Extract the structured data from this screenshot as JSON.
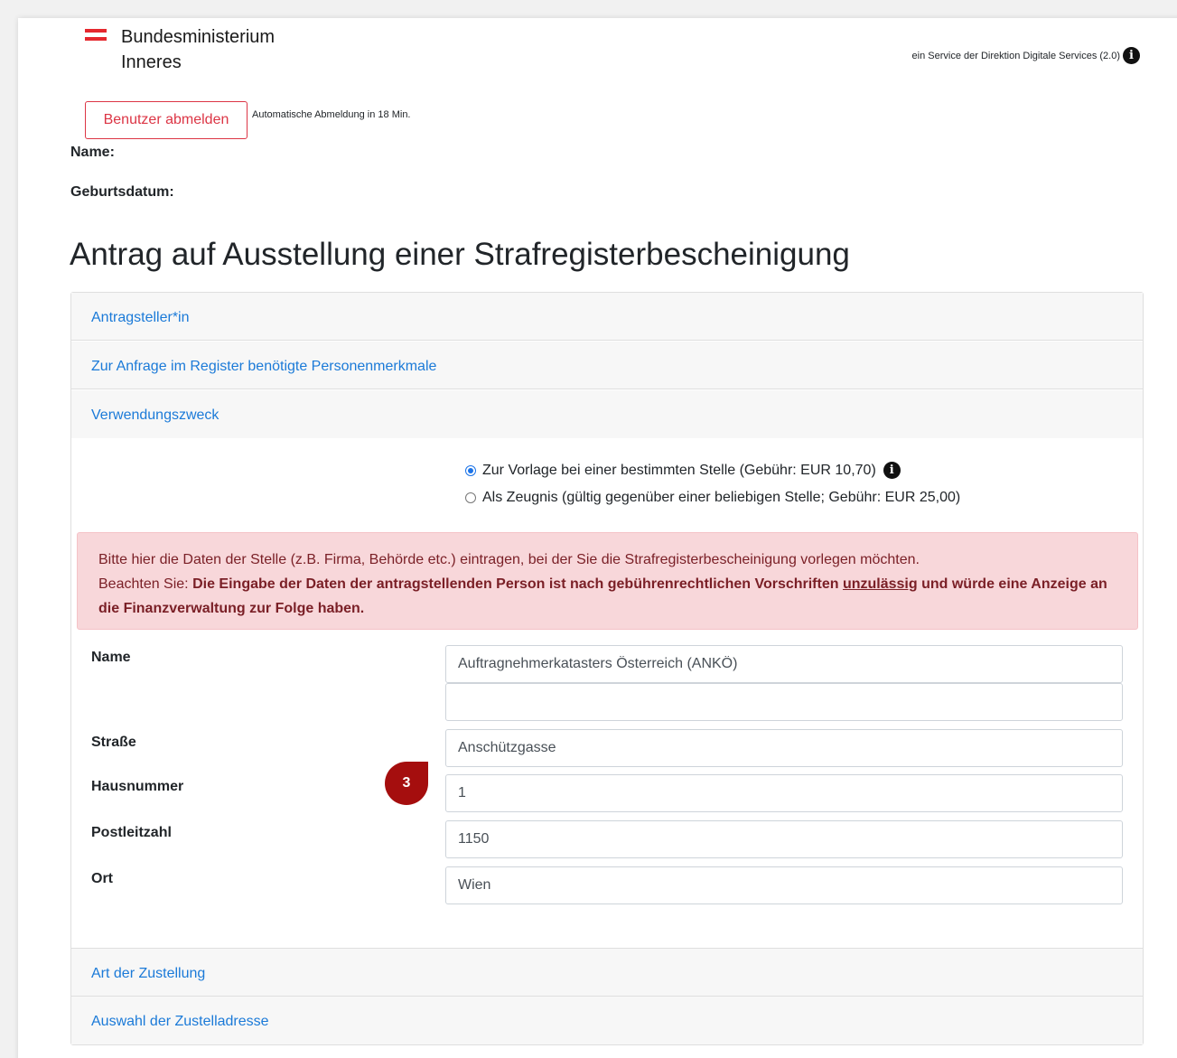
{
  "header": {
    "logo_line1": "Bundesministerium",
    "logo_line2": "Inneres",
    "service_text": "ein Service der Direktion Digitale Services (2.0)",
    "info_icon": "info-icon"
  },
  "session": {
    "logout_label": "Benutzer abmelden",
    "auto_logout_text": "Automatische Abmeldung in 18 Min.",
    "name_label": "Name:",
    "dob_label": "Geburtsdatum:"
  },
  "page_title": "Antrag auf Ausstellung einer Strafregisterbescheinigung",
  "accordion": {
    "sections": [
      {
        "label": "Antragsteller*in"
      },
      {
        "label": "Zur Anfrage im Register benötigte Personenmerkmale"
      },
      {
        "label": "Verwendungszweck"
      },
      {
        "label": "Art der Zustellung"
      },
      {
        "label": "Auswahl der Zustelladresse"
      }
    ]
  },
  "purpose": {
    "options": [
      {
        "label": "Zur Vorlage bei einer bestimmten Stelle (Gebühr: EUR 10,70)",
        "checked": true
      },
      {
        "label": "Als Zeugnis (gültig gegenüber einer beliebigen Stelle; Gebühr: EUR 25,00)",
        "checked": false
      }
    ]
  },
  "alert": {
    "line1": "Bitte hier die Daten der Stelle (z.B. Firma, Behörde etc.) eintragen, bei der Sie die Strafregisterbescheinigung vorlegen möchten.",
    "prefix": "Beachten Sie: ",
    "bold_part1": "Die Eingabe der Daten der antragstellenden Person ist nach gebührenrechtlichen Vorschriften ",
    "underlined": "unzulässig",
    "bold_part2": " und würde eine Anzeige an die Finanzverwaltung zur Folge haben."
  },
  "form": {
    "name_label": "Name",
    "name_value": "Auftragnehmerkatasters Österreich (ANKÖ)",
    "name_value2": "",
    "street_label": "Straße",
    "street_value": "Anschützgasse",
    "house_label": "Hausnummer",
    "house_value": "1",
    "zip_label": "Postleitzahl",
    "zip_value": "1150",
    "city_label": "Ort",
    "city_value": "Wien"
  },
  "step_badge": "3",
  "colors": {
    "accent_red": "#e5282e",
    "link_blue": "#1b7ad8",
    "danger": "#dc3545",
    "alert_bg": "#f8d7da",
    "badge": "#a50e0e"
  }
}
